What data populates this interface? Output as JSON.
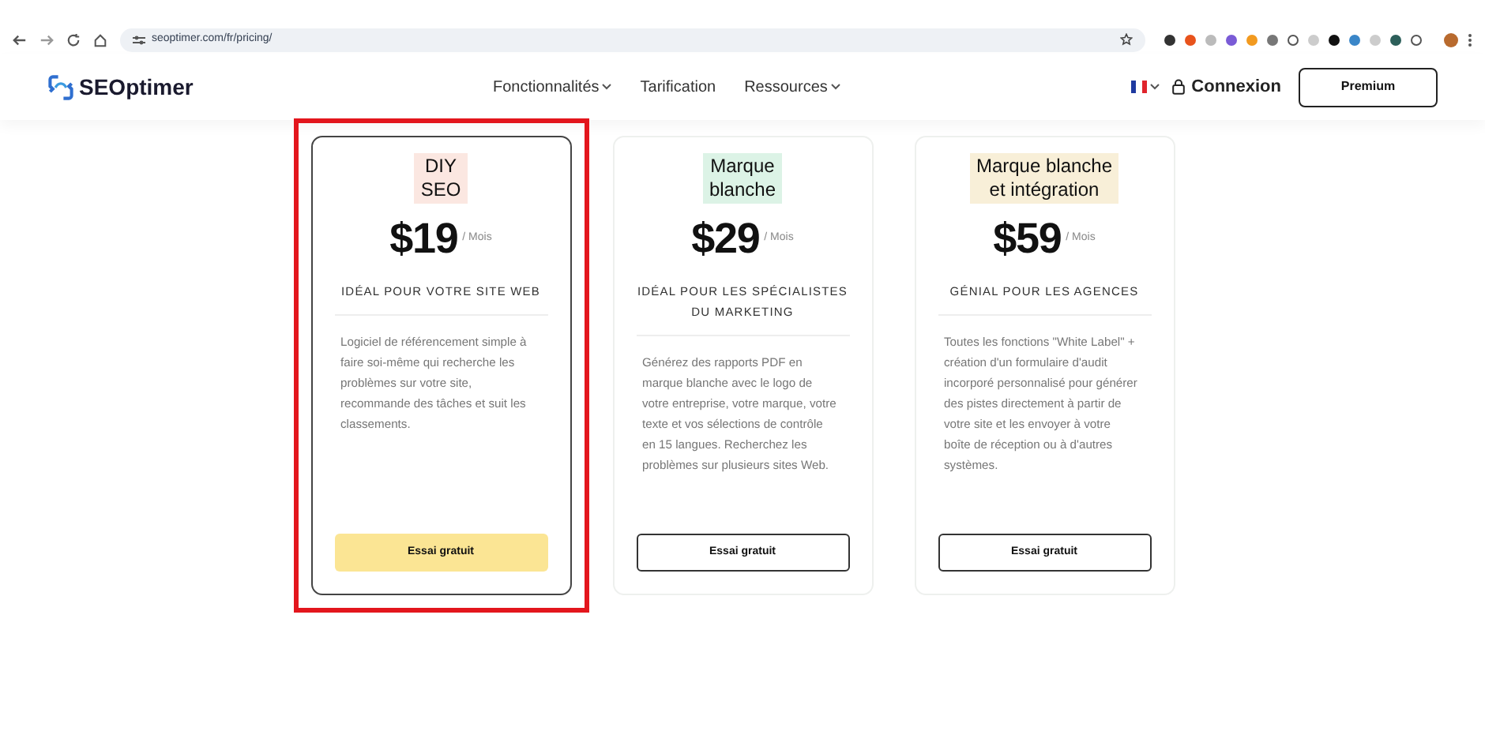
{
  "browser": {
    "url": "seoptimer.com/fr/pricing/"
  },
  "header": {
    "logo": "SEOptimer",
    "nav": [
      {
        "label": "Fonctionnalités",
        "dropdown": true
      },
      {
        "label": "Tarification",
        "dropdown": false
      },
      {
        "label": "Ressources",
        "dropdown": true
      }
    ],
    "login": "Connexion",
    "premium": "Premium"
  },
  "plans": [
    {
      "name": "DIY\nSEO",
      "color": "#fbe7e1",
      "price": "$19",
      "period": "/ Mois",
      "audience": "IDÉAL POUR VOTRE SITE WEB",
      "description": "Logiciel de référencement simple à faire soi-même qui recherche les problèmes sur votre site, recommande des tâches et suit les classements.",
      "button": "Essai gratuit",
      "selected": true
    },
    {
      "name": "Marque\nblanche",
      "color": "#dcf3e6",
      "price": "$29",
      "period": "/ Mois",
      "audience": "IDÉAL POUR LES SPÉCIALISTES DU MARKETING",
      "description": "Générez des rapports PDF en marque blanche avec le logo de votre entreprise, votre marque, votre texte et vos sélections de contrôle en 15 langues. Recherchez les problèmes sur plusieurs sites Web.",
      "button": "Essai gratuit",
      "selected": false
    },
    {
      "name": "Marque blanche\net intégration",
      "color": "#f8efd8",
      "price": "$59",
      "period": "/ Mois",
      "audience": "GÉNIAL POUR LES AGENCES",
      "description": "Toutes les fonctions \"White Label\" + création d'un formulaire d'audit incorporé personnalisé pour générer des pistes directement à partir de votre site et les envoyer à votre boîte de réception ou à d'autres systèmes.",
      "button": "Essai gratuit",
      "selected": false
    }
  ]
}
